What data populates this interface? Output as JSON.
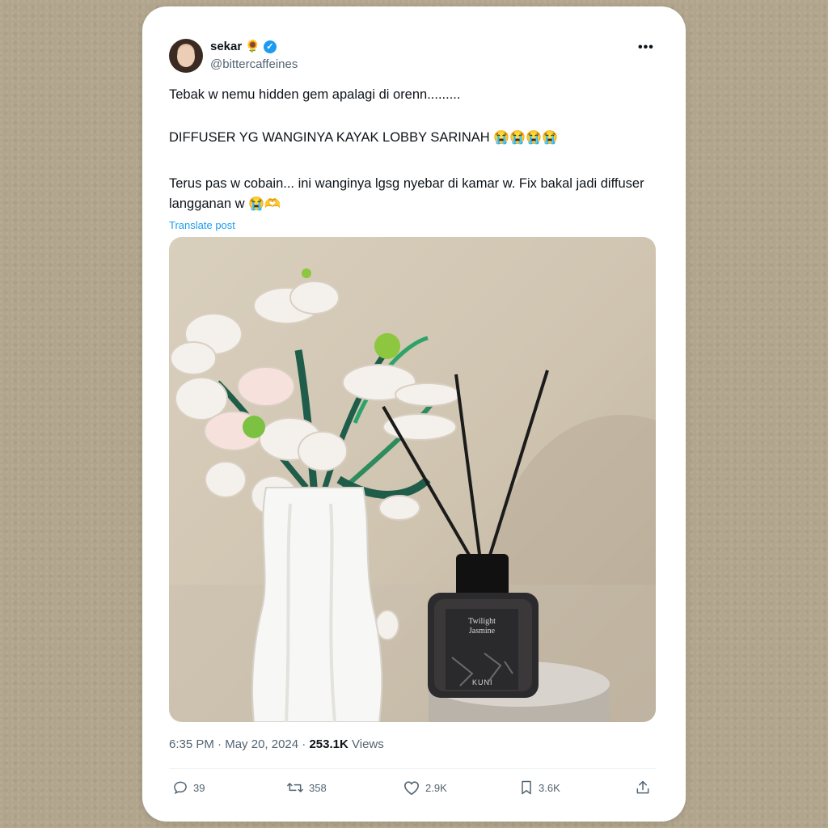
{
  "user": {
    "name": "sekar",
    "name_emoji": "🌻",
    "verified_mark": "✓",
    "handle": "@bittercaffeines",
    "more_label": "•••"
  },
  "tweet": {
    "line1": "Tebak w nemu hidden gem apalagi di orenn.........",
    "line2": "DIFFUSER YG WANGINYA KAYAK LOBBY SARINAH",
    "line2_emoji": "😭😭😭😭",
    "line3": "Terus pas w cobain... ini wanginya lgsg nyebar di kamar w. Fix bakal jadi diffuser langganan w",
    "line3_emoji": "😭🫶",
    "translate_label": "Translate post"
  },
  "photo": {
    "label_line1": "Twilight",
    "label_line2": "Jasmine",
    "brand": "KUNI"
  },
  "meta": {
    "time": "6:35 PM",
    "date": "May 20, 2024",
    "views_count": "253.1K",
    "views_label": "Views"
  },
  "actions": {
    "replies": "39",
    "reposts": "358",
    "likes": "2.9K",
    "bookmarks": "3.6K"
  },
  "colors": {
    "background": "#b2a58d",
    "card": "#ffffff",
    "accent": "#1d9bf0",
    "text": "#0f1419",
    "muted": "#536471"
  },
  "icons": [
    "verified-icon",
    "more-icon",
    "reply-icon",
    "repost-icon",
    "like-icon",
    "bookmark-icon",
    "share-icon"
  ]
}
